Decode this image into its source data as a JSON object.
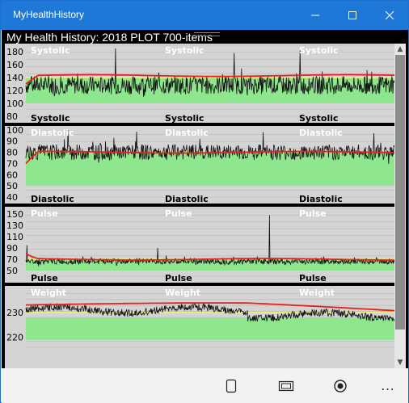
{
  "window": {
    "title": "MyHealthHistory"
  },
  "heading": "My Health History: 2018 PLOT 700-items",
  "panels": [
    {
      "key": "systolic",
      "label": "Systolic",
      "ticks": [
        180,
        160,
        140,
        120,
        100,
        80
      ],
      "ylim": [
        80,
        190
      ],
      "band": [
        100,
        140
      ],
      "target": 140,
      "base": 128,
      "noise": 14,
      "spikes": [
        {
          "i": 170,
          "v": 185
        },
        {
          "i": 395,
          "v": 178
        },
        {
          "i": 520,
          "v": 182
        }
      ],
      "avg_start": 130,
      "avg": 143
    },
    {
      "key": "diastolic",
      "label": "Diastolic",
      "ticks": [
        100,
        90,
        80,
        70,
        60,
        50,
        40
      ],
      "ylim": [
        40,
        102
      ],
      "band": [
        50,
        80
      ],
      "target": 80,
      "base": 80,
      "noise": 7,
      "spikes": [
        {
          "i": 80,
          "v": 100
        },
        {
          "i": 450,
          "v": 98
        },
        {
          "i": 660,
          "v": 97
        }
      ],
      "avg_start": 70,
      "avg": 80
    },
    {
      "key": "pulse",
      "label": "Pulse",
      "ticks": [
        150,
        130,
        110,
        90,
        70,
        50
      ],
      "ylim": [
        40,
        160
      ],
      "band": [
        50,
        70
      ],
      "target": 70,
      "base": 66,
      "noise": 5,
      "spikes": [
        {
          "i": 2,
          "v": 95
        },
        {
          "i": 462,
          "v": 148
        },
        {
          "i": 250,
          "v": 90
        }
      ],
      "avg_start": 80,
      "avg": 70
    },
    {
      "key": "weight",
      "label": "Weight",
      "ticks": [
        230,
        220
      ],
      "ylim": [
        216,
        240
      ],
      "band": [
        219,
        228
      ],
      "target": 230,
      "base": 231,
      "noise": 1.5,
      "spikes": [],
      "avg_start": 231,
      "avg": 233
    }
  ],
  "colors": {
    "band": "#8ee68e",
    "target": "#f0f078",
    "average": "#e8201e",
    "reading": "#111111",
    "grid": "#b8b8b8",
    "label_dark": "#000000",
    "label_light": "#ffffff"
  },
  "bottom": {
    "icons": [
      "device-icon",
      "tablet-mode-icon",
      "record-icon",
      "more-icon"
    ],
    "more_label": "..."
  }
}
